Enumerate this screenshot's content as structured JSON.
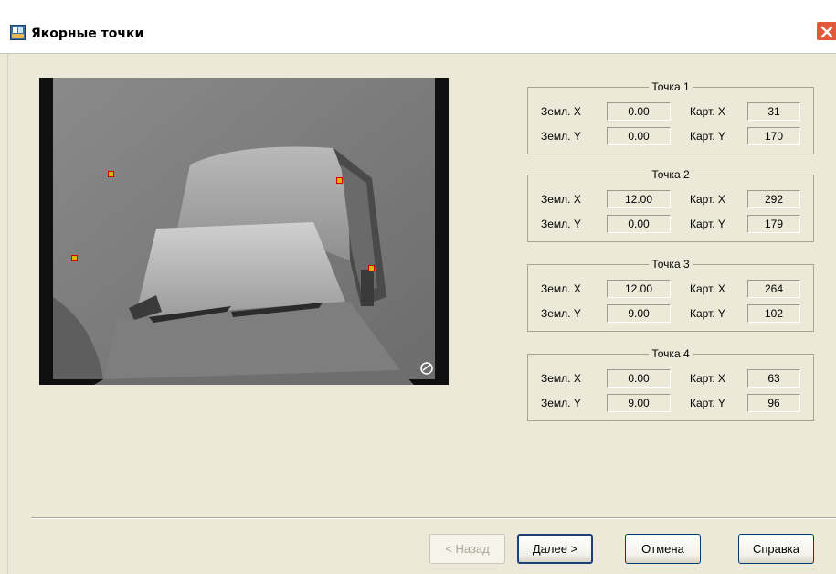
{
  "window": {
    "title": "Якорные точки"
  },
  "points": [
    {
      "title": "Точка 1",
      "ground_x_label": "Земл. X",
      "ground_y_label": "Земл. Y",
      "ground_x": "0.00",
      "ground_y": "0.00",
      "map_x_label": "Карт. X",
      "map_y_label": "Карт. Y",
      "map_x": "31",
      "map_y": "170"
    },
    {
      "title": "Точка 2",
      "ground_x_label": "Земл. X",
      "ground_y_label": "Земл. Y",
      "ground_x": "12.00",
      "ground_y": "0.00",
      "map_x_label": "Карт. X",
      "map_y_label": "Карт. Y",
      "map_x": "292",
      "map_y": "179"
    },
    {
      "title": "Точка 3",
      "ground_x_label": "Земл. X",
      "ground_y_label": "Земл. Y",
      "ground_x": "12.00",
      "ground_y": "9.00",
      "map_x_label": "Карт. X",
      "map_y_label": "Карт. Y",
      "map_x": "264",
      "map_y": "102"
    },
    {
      "title": "Точка 4",
      "ground_x_label": "Земл. X",
      "ground_y_label": "Земл. Y",
      "ground_x": "0.00",
      "ground_y": "9.00",
      "map_x_label": "Карт. X",
      "map_y_label": "Карт. Y",
      "map_x": "63",
      "map_y": "96"
    }
  ],
  "buttons": {
    "back": "< Назад",
    "next": "Далее >",
    "cancel": "Отмена",
    "help": "Справка"
  },
  "colors": {
    "window_bg": "#ece9d8",
    "close_button": "#e3583a",
    "marker_fill": "#e0b400",
    "marker_border": "#d10000"
  }
}
